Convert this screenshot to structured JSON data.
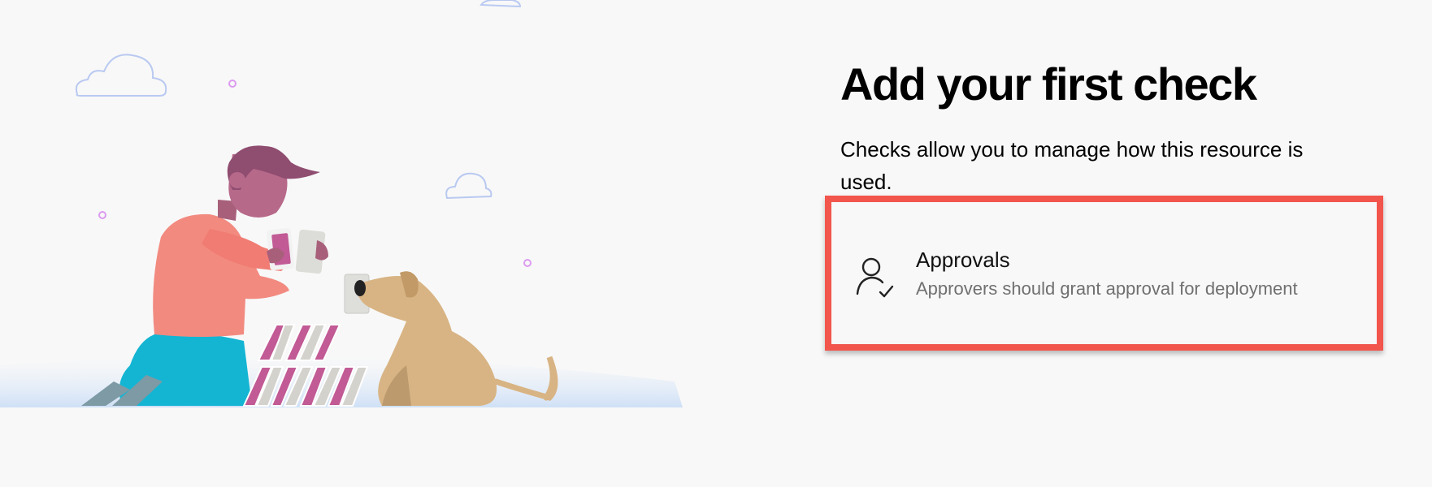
{
  "page": {
    "title": "Add your first check",
    "description": "Checks allow you to manage how this resource is used."
  },
  "checks": [
    {
      "title": "Approvals",
      "subtitle": "Approvers should grant approval for deployment",
      "icon": "person-check-icon"
    }
  ],
  "colors": {
    "highlight": "#f2554c",
    "background": "#f8f8f8",
    "subtitle": "#707070"
  }
}
